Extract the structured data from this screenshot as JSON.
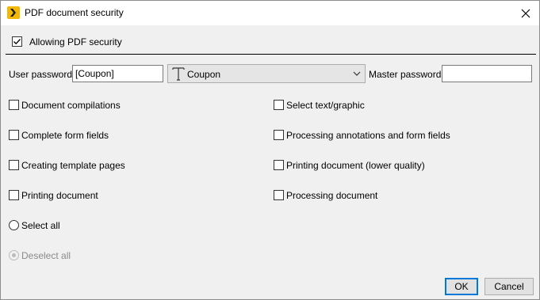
{
  "window": {
    "title": "PDF document security",
    "close_glyph": "✕"
  },
  "security": {
    "allow_label": "Allowing PDF security",
    "allow_checked": true
  },
  "passwords": {
    "user_label": "User password:",
    "user_value": "[Coupon]",
    "field_dropdown_value": "Coupon",
    "master_label": "Master password:",
    "master_value": ""
  },
  "permissions": {
    "left": [
      {
        "label": "Document compilations",
        "checked": false
      },
      {
        "label": "Complete form fields",
        "checked": false
      },
      {
        "label": "Creating template pages",
        "checked": false
      },
      {
        "label": "Printing document",
        "checked": false
      }
    ],
    "right": [
      {
        "label": "Select text/graphic",
        "checked": false
      },
      {
        "label": "Processing annotations and form fields",
        "checked": false
      },
      {
        "label": "Printing document (lower quality)",
        "checked": false
      },
      {
        "label": "Processing document",
        "checked": false
      }
    ]
  },
  "selection": {
    "select_all_label": "Select all",
    "deselect_all_label": "Deselect all"
  },
  "buttons": {
    "ok": "OK",
    "cancel": "Cancel"
  },
  "colors": {
    "app_icon": "#f2b705",
    "default_button_border": "#0078d7",
    "disabled_text": "#8a8a8a"
  },
  "icons": {
    "app": "pdf-security-app-icon",
    "close": "close-icon",
    "field": "text-field-icon",
    "dropdown": "chevron-down-icon"
  }
}
